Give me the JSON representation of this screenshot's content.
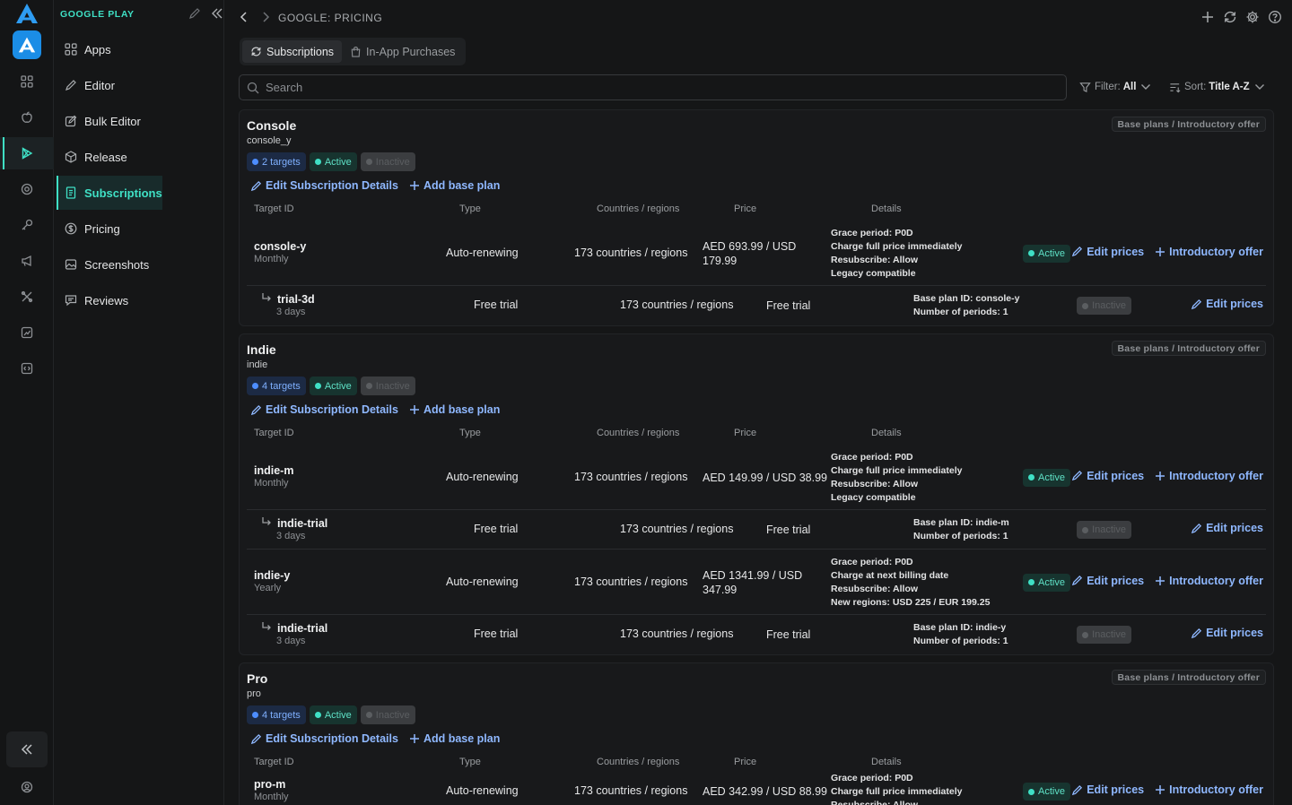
{
  "sidebar": {
    "section_title": "GOOGLE PLAY",
    "items": [
      {
        "label": "Apps",
        "icon": "apps-grid-icon"
      },
      {
        "label": "Editor",
        "icon": "pencil-icon"
      },
      {
        "label": "Bulk Editor",
        "icon": "bulk-edit-icon"
      },
      {
        "label": "Release",
        "icon": "package-icon"
      },
      {
        "label": "Subscriptions",
        "icon": "receipt-icon"
      },
      {
        "label": "Pricing",
        "icon": "dollar-circle-icon"
      },
      {
        "label": "Screenshots",
        "icon": "image-icon"
      },
      {
        "label": "Reviews",
        "icon": "review-icon"
      }
    ]
  },
  "header": {
    "breadcrumb": "GOOGLE: PRICING"
  },
  "tabs": [
    {
      "label": "Subscriptions",
      "icon": "refresh-icon"
    },
    {
      "label": "In-App Purchases",
      "icon": "bag-icon"
    }
  ],
  "search": {
    "placeholder": "Search"
  },
  "filter": {
    "label": "Filter:",
    "value": "All"
  },
  "sort": {
    "label": "Sort:",
    "value": "Title A-Z"
  },
  "colors": {
    "accent": "#3fe0c5",
    "link": "#8fb8ff",
    "targets": "#4d8dff"
  },
  "common": {
    "corner_label": "Base plans / Introductory offer",
    "active": "Active",
    "inactive": "Inactive",
    "edit_details": "Edit Subscription Details",
    "add_base_plan": "Add base plan",
    "edit_prices": "Edit prices",
    "intro_offer": "Introductory offer",
    "columns": [
      "Target ID",
      "Type",
      "Countries / regions",
      "Price",
      "Details"
    ]
  },
  "subscriptions": [
    {
      "name": "Console",
      "product_id": "console_y",
      "targets": "2 targets",
      "rows": [
        {
          "kind": "base",
          "id": "console-y",
          "period": "Monthly",
          "type": "Auto-renewing",
          "regions": "173 countries / regions",
          "price_1": "AED 693.99 / USD",
          "price_2": "179.99",
          "details": [
            "Grace period: P0D",
            "Charge full price immediately",
            "Resubscribe: Allow",
            "Legacy compatible"
          ],
          "status": "Active"
        },
        {
          "kind": "offer",
          "id": "trial-3d",
          "period": "3 days",
          "type": "Free trial",
          "regions": "173 countries / regions",
          "price_1": "Free trial",
          "details": [
            "Base plan ID: console-y",
            "Number of periods: 1"
          ],
          "status": "Inactive"
        }
      ]
    },
    {
      "name": "Indie",
      "product_id": "indie",
      "targets": "4 targets",
      "rows": [
        {
          "kind": "base",
          "id": "indie-m",
          "period": "Monthly",
          "type": "Auto-renewing",
          "regions": "173 countries / regions",
          "price_1": "AED 149.99 / USD 38.99",
          "details": [
            "Grace period: P0D",
            "Charge full price immediately",
            "Resubscribe: Allow",
            "Legacy compatible"
          ],
          "status": "Active"
        },
        {
          "kind": "offer",
          "id": "indie-trial",
          "period": "3 days",
          "type": "Free trial",
          "regions": "173 countries / regions",
          "price_1": "Free trial",
          "details": [
            "Base plan ID: indie-m",
            "Number of periods: 1"
          ],
          "status": "Inactive"
        },
        {
          "kind": "base",
          "id": "indie-y",
          "period": "Yearly",
          "type": "Auto-renewing",
          "regions": "173 countries / regions",
          "price_1": "AED 1341.99 / USD",
          "price_2": "347.99",
          "details": [
            "Grace period: P0D",
            "Charge at next billing date",
            "Resubscribe: Allow",
            "New regions: USD 225 / EUR 199.25"
          ],
          "status": "Active"
        },
        {
          "kind": "offer",
          "id": "indie-trial",
          "period": "3 days",
          "type": "Free trial",
          "regions": "173 countries / regions",
          "price_1": "Free trial",
          "details": [
            "Base plan ID: indie-y",
            "Number of periods: 1"
          ],
          "status": "Inactive"
        }
      ]
    },
    {
      "name": "Pro",
      "product_id": "pro",
      "targets": "4 targets",
      "rows": [
        {
          "kind": "base",
          "id": "pro-m",
          "period": "Monthly",
          "type": "Auto-renewing",
          "regions": "173 countries / regions",
          "price_1": "AED 342.99 / USD 88.99",
          "details": [
            "Grace period: P0D",
            "Charge full price immediately",
            "Resubscribe: Allow"
          ],
          "status": "Active"
        }
      ]
    }
  ]
}
